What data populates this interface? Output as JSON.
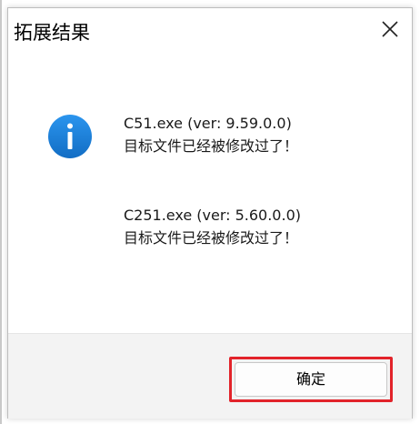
{
  "dialog": {
    "title": "拓展结果",
    "close_icon": "close-icon",
    "icon": "info-icon",
    "icon_color": "#1b7fd6",
    "messages": [
      {
        "line1": "C51.exe (ver: 9.59.0.0)",
        "line2": "目标文件已经被修改过了！"
      },
      {
        "line1": "C251.exe (ver: 5.60.0.0)",
        "line2": "目标文件已经被修改过了！"
      }
    ],
    "ok_label": "确定",
    "highlight_color": "#e2232a"
  }
}
